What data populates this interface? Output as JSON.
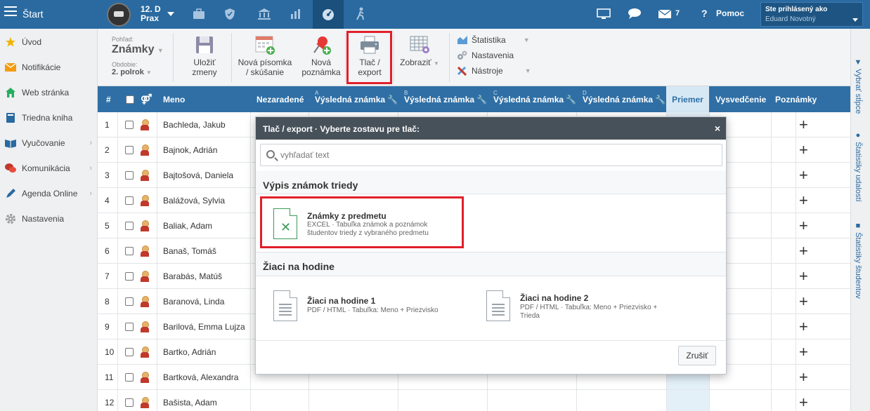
{
  "topbar": {
    "start_label": "Štart",
    "class_name_line1": "12. D",
    "class_name_line2": "Prax",
    "messages_count": "7",
    "help_label": "Pomoc",
    "logged_in_label": "Ste prihlásený ako",
    "user_name": "Eduard Novotný",
    "icons": [
      "briefcase-icon",
      "shield-icon",
      "bank-icon",
      "bar-chart-icon",
      "gauge-icon",
      "hiker-icon",
      "monitor-icon",
      "chat-icon",
      "mail-icon",
      "help-icon"
    ]
  },
  "sidebar": {
    "items": [
      {
        "label": "Úvod",
        "icon": "star-icon",
        "color": "#f0b400"
      },
      {
        "label": "Notifikácie",
        "icon": "envelope-icon",
        "color": "#f39c12"
      },
      {
        "label": "Web stránka",
        "icon": "house-icon",
        "color": "#27ae60"
      },
      {
        "label": "Triedna kniha",
        "icon": "book-icon",
        "color": "#2a6aa0"
      },
      {
        "label": "Vyučovanie",
        "icon": "open-book-icon",
        "color": "#2a6aa0"
      },
      {
        "label": "Komunikácia",
        "icon": "chat-bubbles-icon",
        "color": "#c0392b"
      },
      {
        "label": "Agenda Online",
        "icon": "pen-icon",
        "color": "#2a6aa0"
      },
      {
        "label": "Nastavenia",
        "icon": "gear-icon",
        "color": "#999"
      }
    ]
  },
  "toolbar": {
    "view_label": "Pohľad:",
    "view_value": "Známky",
    "period_label": "Obdobie:",
    "period_value": "2. polrok",
    "save_label_1": "Uložiť",
    "save_label_2": "zmeny",
    "new_test_label_1": "Nová písomka",
    "new_test_label_2": "/ skúšanie",
    "new_note_label_1": "Nová",
    "new_note_label_2": "poznámka",
    "print_label_1": "Tlač /",
    "print_label_2": "export",
    "display_label": "Zobraziť",
    "statistics_label": "Štatistika",
    "settings_label": "Nastavenia",
    "tools_label": "Nástroje"
  },
  "rightbar": {
    "choose_columns": "Vybrať stĺpce",
    "event_stats": "Štatistiky udalostí",
    "student_stats": "Štatistiky študentov"
  },
  "table": {
    "headers": {
      "num": "#",
      "name": "Meno",
      "unassigned": "Nezaradené",
      "final_a": "Výsledná známka",
      "final_b": "Výsledná známka",
      "final_c": "Výsledná známka",
      "final_d": "Výsledná známka",
      "letter_a": "A",
      "letter_b": "B",
      "letter_c": "C",
      "letter_d": "D",
      "average": "Priemer",
      "report_card": "Vysvedčenie",
      "notes": "Poznámky"
    },
    "rows": [
      {
        "num": "1",
        "name": "Bachleda, Jakub"
      },
      {
        "num": "2",
        "name": "Bajnok, Adrián"
      },
      {
        "num": "3",
        "name": "Bajtošová, Daniela"
      },
      {
        "num": "4",
        "name": "Balážová, Sylvia"
      },
      {
        "num": "5",
        "name": "Baliak, Adam"
      },
      {
        "num": "6",
        "name": "Banaš, Tomáš"
      },
      {
        "num": "7",
        "name": "Barabás, Matúš"
      },
      {
        "num": "8",
        "name": "Baranová, Linda"
      },
      {
        "num": "9",
        "name": "Barilová, Emma Lujza"
      },
      {
        "num": "10",
        "name": "Bartko, Adrián"
      },
      {
        "num": "11",
        "name": "Bartková, Alexandra"
      },
      {
        "num": "12",
        "name": "Bašista, Adam"
      }
    ]
  },
  "modal": {
    "title": "Tlač / export · Vyberte zostavu pre tlač:",
    "close": "×",
    "search_placeholder": "vyhľadať text",
    "section1": "Výpis známok triedy",
    "report1_title": "Známky z predmetu",
    "report1_desc_1": "EXCEL · Tabuľka známok a poznámok",
    "report1_desc_2": "študentov triedy z vybraného predmetu",
    "section2": "Žiaci na hodine",
    "report2_title": "Žiaci na hodine 1",
    "report2_desc_1": "PDF / HTML · Tabuľka: Meno + Priezvisko",
    "report3_title": "Žiaci na hodine 2",
    "report3_desc_1": "PDF / HTML · Tabuľka: Meno + Priezvisko +",
    "report3_desc_2": "Trieda",
    "cancel": "Zrušiť"
  }
}
